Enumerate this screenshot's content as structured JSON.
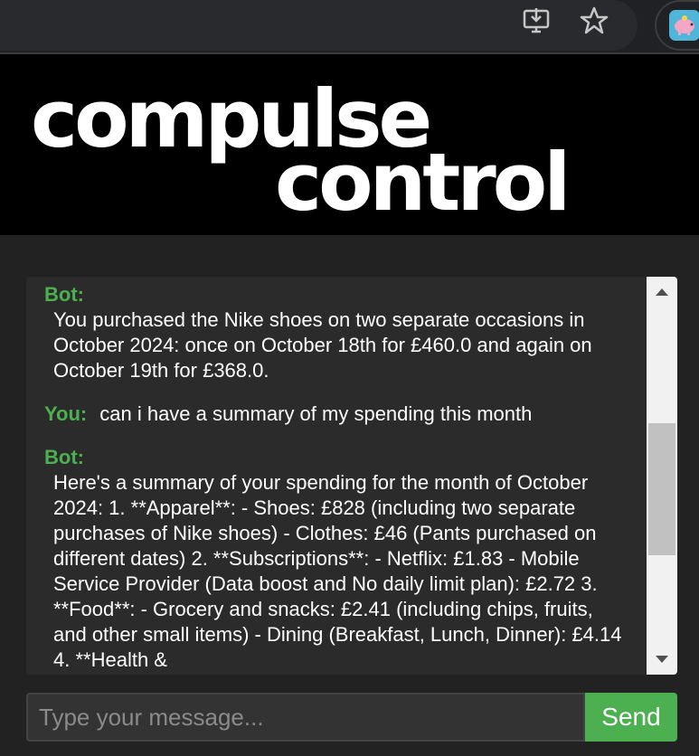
{
  "browser": {
    "install_icon": "install-app-icon",
    "bookmark_icon": "star-icon",
    "extension_icon": "piggy-bank-icon"
  },
  "header": {
    "logo_line1": "compulse",
    "logo_line2": "control"
  },
  "chat": {
    "messages": [
      {
        "sender": "Bot:",
        "text": "You purchased the Nike shoes on two separate occasions in October 2024: once on October 18th for £460.0 and again on October 19th for £368.0."
      },
      {
        "sender": "You:",
        "text": "can i have a summary of my spending this month"
      },
      {
        "sender": "Bot:",
        "text": "Here's a summary of your spending for the month of October 2024: 1. **Apparel**: - Shoes: £828 (including two separate purchases of Nike shoes) - Clothes: £46 (Pants purchased on different dates) 2. **Subscriptions**: - Netflix: £1.83 - Mobile Service Provider (Data boost and No daily limit plan): £2.72 3. **Food**: - Grocery and snacks: £2.41 (including chips, fruits, and other small items) - Dining (Breakfast, Lunch, Dinner): £4.14 4. **Health &"
      }
    ]
  },
  "input": {
    "placeholder": "Type your message...",
    "value": ""
  },
  "send_button": {
    "label": "Send"
  },
  "colors": {
    "accent": "#4caf50",
    "background": "#222222",
    "header_bg": "#000000",
    "chat_bg": "#2b2b2b"
  }
}
